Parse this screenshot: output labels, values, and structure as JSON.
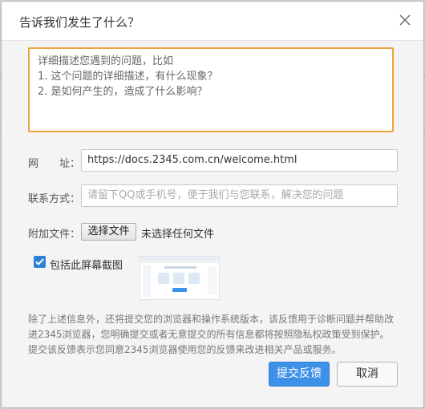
{
  "dialog": {
    "title": "告诉我们发生了什么？"
  },
  "description": {
    "placeholder": "详细描述您遇到的问题，比如\n1. 这个问题的详细描述，有什么现象？\n2. 是如何产生的，造成了什么影响？"
  },
  "url_field": {
    "label": "网　　址：",
    "value": "https://docs.2345.com.cn/welcome.html"
  },
  "contact_field": {
    "label": "联系方式：",
    "placeholder": "请留下QQ或手机号，便于我们与您联系，解决您的问题"
  },
  "attachment": {
    "label": "附加文件：",
    "button_label": "选择文件",
    "status": "未选择任何文件"
  },
  "screenshot_option": {
    "label": "包括此屏幕截图",
    "checked": true
  },
  "info_text": "除了上述信息外，还将提交您的浏览器和操作系统版本，该反馈用于诊断问题并帮助改进2345浏览器，您明确提交或者无意提交的所有信息都将按照隐私权政策受到保护。提交该反馈表示您同意2345浏览器使用您的反馈来改进相关产品或服务。",
  "buttons": {
    "submit": "提交反馈",
    "cancel": "取消"
  },
  "colors": {
    "accent": "#3e91e8",
    "focus_border": "#f0a23c"
  }
}
